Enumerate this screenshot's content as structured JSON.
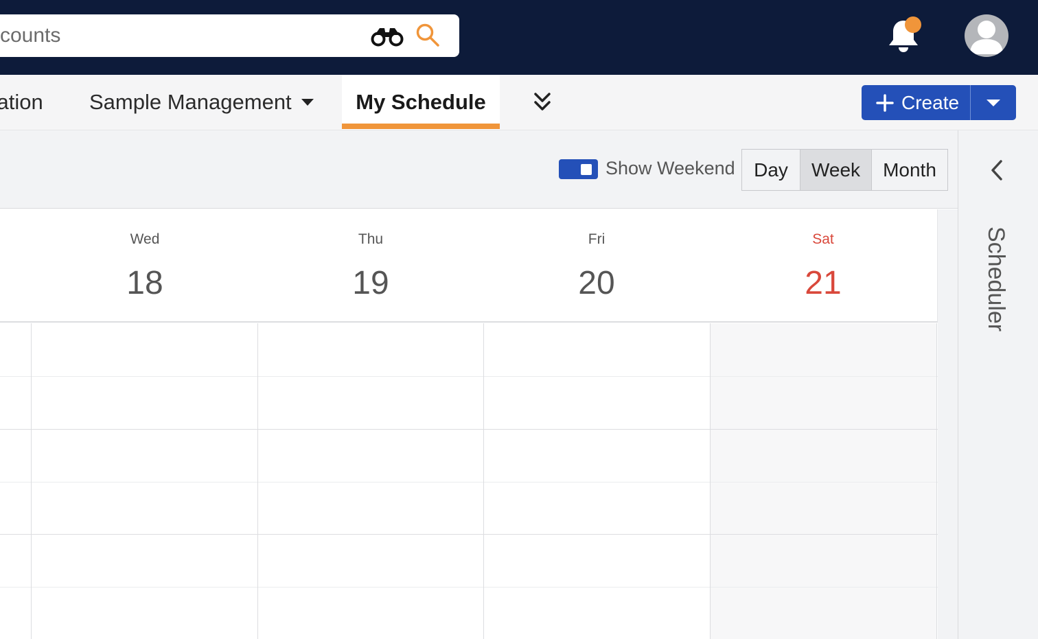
{
  "search": {
    "value": "counts"
  },
  "header": {
    "icons": [
      "binoculars-icon",
      "search-icon",
      "bell-icon",
      "avatar-icon"
    ],
    "notification_dot_color": "#f0953a"
  },
  "nav": {
    "items": [
      {
        "label": "cation"
      },
      {
        "label": "Sample Management",
        "has_dropdown": true
      },
      {
        "label": "My Schedule",
        "active": true
      }
    ],
    "more_icon": "double-chevron-down-icon",
    "create_label": "Create"
  },
  "toolbar": {
    "show_weekend_label": "Show Weekend",
    "show_weekend_on": true,
    "views": [
      "Day",
      "Week",
      "Month"
    ],
    "selected_view": "Week"
  },
  "calendar": {
    "days": [
      {
        "dow": "Wed",
        "date": "18"
      },
      {
        "dow": "Thu",
        "date": "19"
      },
      {
        "dow": "Fri",
        "date": "20"
      },
      {
        "dow": "Sat",
        "date": "21",
        "weekend": true
      }
    ]
  },
  "side_panel": {
    "title": "Scheduler"
  },
  "colors": {
    "topbar": "#0d1b3a",
    "accent_orange": "#f0953a",
    "primary_blue": "#2450b8",
    "weekend_red": "#d9483b"
  }
}
